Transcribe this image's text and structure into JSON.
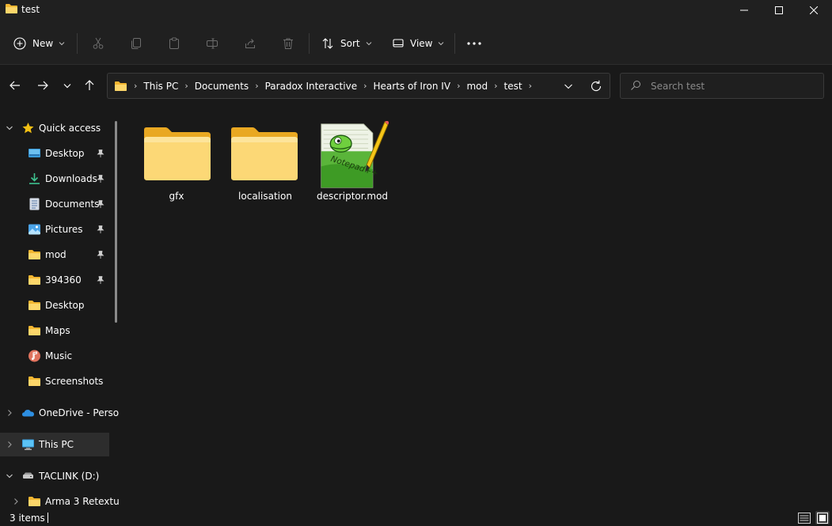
{
  "window": {
    "title": "test",
    "minimize_icon": "minimize-icon",
    "maximize_icon": "maximize-icon",
    "close_icon": "close-icon"
  },
  "commandbar": {
    "new_label": "New",
    "sort_label": "Sort",
    "view_label": "View",
    "icons": [
      "cut-icon",
      "copy-icon",
      "paste-icon",
      "rename-icon",
      "share-icon",
      "delete-icon",
      "more-icon"
    ]
  },
  "address": {
    "breadcrumbs": [
      "This PC",
      "Documents",
      "Paradox Interactive",
      "Hearts of Iron IV",
      "mod",
      "test"
    ]
  },
  "search": {
    "placeholder": "Search test"
  },
  "sidebar": {
    "quick_access": {
      "label": "Quick access",
      "items": [
        {
          "label": "Desktop",
          "icon": "desktop-icon",
          "pinned": true
        },
        {
          "label": "Downloads",
          "icon": "downloads-icon",
          "pinned": true
        },
        {
          "label": "Documents",
          "icon": "documents-icon",
          "pinned": true
        },
        {
          "label": "Pictures",
          "icon": "pictures-icon",
          "pinned": true
        },
        {
          "label": "mod",
          "icon": "folder-icon",
          "pinned": true
        },
        {
          "label": "394360",
          "icon": "folder-icon",
          "pinned": true
        },
        {
          "label": "Desktop",
          "icon": "folder-icon",
          "pinned": false
        },
        {
          "label": "Maps",
          "icon": "folder-icon",
          "pinned": false
        },
        {
          "label": "Music",
          "icon": "music-icon",
          "pinned": false
        },
        {
          "label": "Screenshots",
          "icon": "folder-icon",
          "pinned": false
        }
      ]
    },
    "onedrive_label": "OneDrive - Perso",
    "thispc_label": "This PC",
    "drive_label": "TACLINK (D:)",
    "drive_child_label": "Arma 3 Retextu"
  },
  "files": [
    {
      "name": "gfx",
      "type": "folder"
    },
    {
      "name": "localisation",
      "type": "folder"
    },
    {
      "name": "descriptor.mod",
      "type": "notepadpp-file"
    }
  ],
  "status": {
    "items_text": "3 items"
  },
  "colors": {
    "background": "#191919",
    "chrome": "#202020",
    "folder_yellow": "#f8c94b",
    "star_yellow": "#f3c014",
    "accent_blue": "#4cc2ff"
  }
}
